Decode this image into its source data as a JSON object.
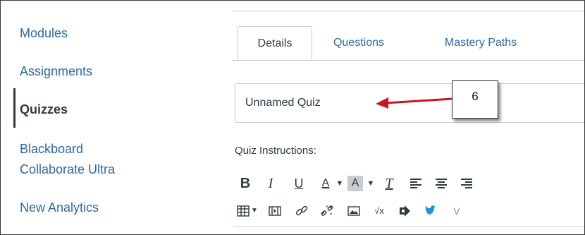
{
  "nav": {
    "items": [
      {
        "label": "Modules",
        "active": false
      },
      {
        "label": "Assignments",
        "active": false
      },
      {
        "label": "Quizzes",
        "active": true
      },
      {
        "label": "Blackboard",
        "active": false
      },
      {
        "label": "Collaborate Ultra",
        "active": false
      },
      {
        "label": "New Analytics",
        "active": false
      }
    ]
  },
  "tabs": [
    {
      "label": "Details",
      "active": true
    },
    {
      "label": "Questions",
      "active": false
    },
    {
      "label": "Mastery Paths",
      "active": false
    }
  ],
  "quiz_title": {
    "value": "Unnamed Quiz"
  },
  "instructions_label": "Quiz Instructions:",
  "toolbar_row1": [
    "bold-icon",
    "italic-icon",
    "underline-icon",
    "text-color-icon",
    "dropdown-caret-icon",
    "background-color-icon",
    "dropdown-caret-icon",
    "clear-formatting-icon",
    "align-left-icon",
    "align-center-icon",
    "align-right-icon"
  ],
  "toolbar_row2": [
    "table-icon",
    "dropdown-caret-icon",
    "media-icon",
    "link-icon",
    "unlink-icon",
    "image-icon",
    "math-icon",
    "embed-icon",
    "twitter-icon",
    "vimeo-icon"
  ],
  "annotation": {
    "label": "6"
  },
  "colors": {
    "link": "#2d6aa3",
    "text": "#2d3b45",
    "border": "#c7cdd1",
    "arrow": "#c8181e"
  }
}
